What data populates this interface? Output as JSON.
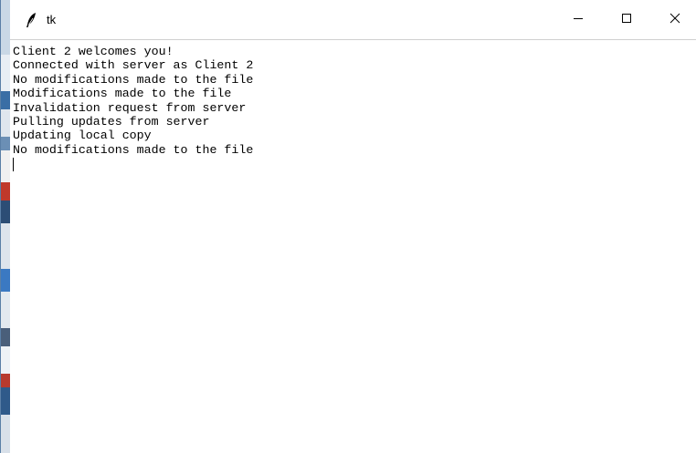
{
  "window": {
    "title": "tk",
    "controls": {
      "minimize": "minimize-icon",
      "maximize": "maximize-icon",
      "close": "close-icon"
    }
  },
  "text_widget": {
    "lines": [
      "Client 2 welcomes you!",
      "Connected with server as Client 2",
      "No modifications made to the file",
      "Modifications made to the file",
      "Invalidation request from server",
      "Pulling updates from server",
      "Updating local copy",
      "No modifications made to the file"
    ]
  },
  "colors": {
    "background": "#ffffff",
    "text": "#000000",
    "titlebar_border": "#d0d0d0"
  }
}
